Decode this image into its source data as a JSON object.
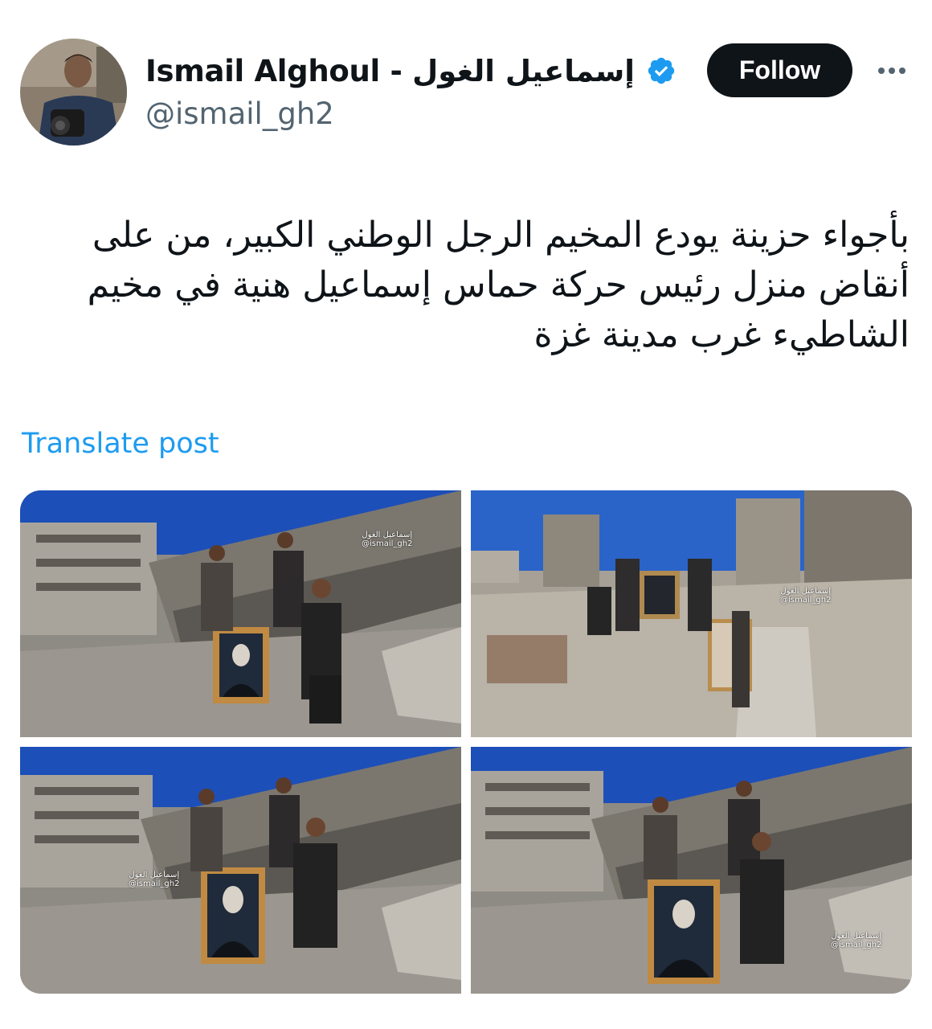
{
  "author": {
    "name": "Ismail Alghoul - إسماعيل الغول",
    "handle": "@ismail_gh2",
    "verified": true
  },
  "actions": {
    "follow_label": "Follow"
  },
  "post": {
    "text": "بأجواء حزينة يودع المخيم الرجل الوطني الكبير، من على أنقاض منزل رئيس حركة حماس إسماعيل هنية في مخيم الشاطيء غرب مدينة غزة",
    "translate_label": "Translate post"
  },
  "media": {
    "watermark_arabic": "إسماعيل الغول",
    "watermark_handle": "@ismail_gh2"
  },
  "colors": {
    "text": "#0f1419",
    "secondary": "#536471",
    "link": "#1d9bf0",
    "verified": "#1d9bf0",
    "follow_bg": "#0f1419"
  }
}
